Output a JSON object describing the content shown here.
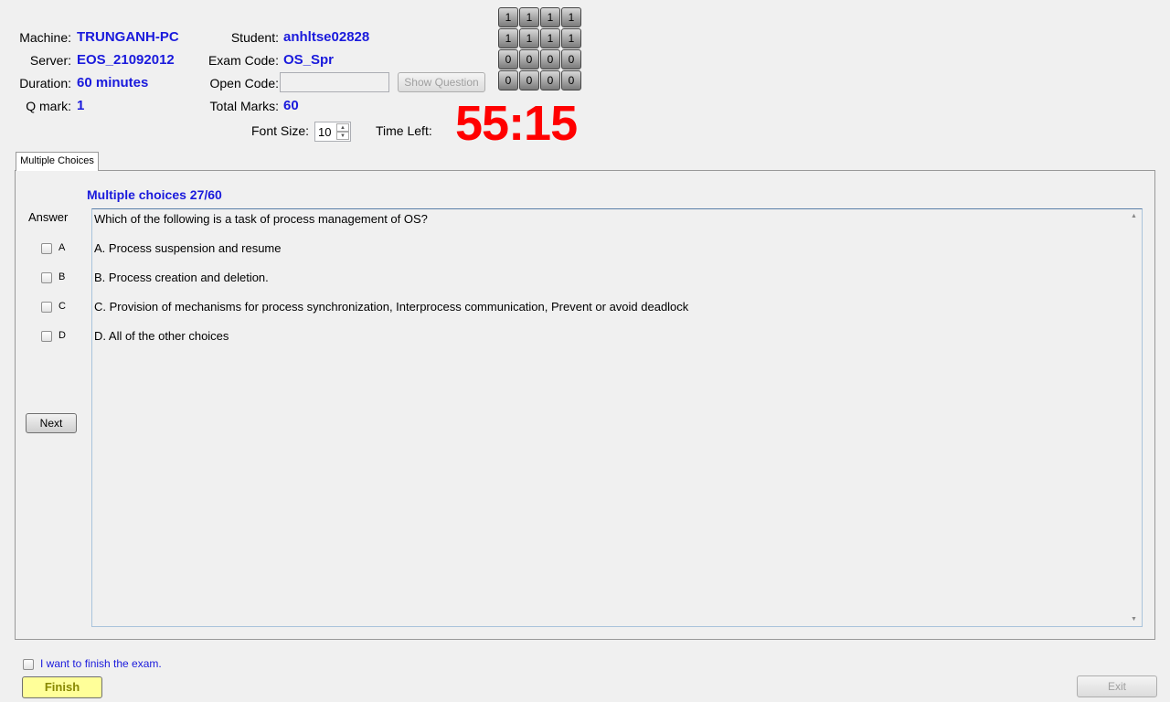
{
  "info": {
    "machine_label": "Machine:",
    "machine": "TRUNGANH-PC",
    "server_label": "Server:",
    "server": "EOS_21092012",
    "duration_label": "Duration:",
    "duration": "60 minutes",
    "qmark_label": "Q mark:",
    "qmark": "1",
    "student_label": "Student:",
    "student": "anhltse02828",
    "examcode_label": "Exam Code:",
    "examcode": "OS_Spr",
    "opencode_label": "Open Code:",
    "opencode_value": "",
    "show_question": "Show Question",
    "totalmarks_label": "Total Marks:",
    "totalmarks": "60",
    "fontsize_label": "Font Size:",
    "fontsize": "10",
    "timeleft_label": "Time Left:",
    "timeleft": "55:15"
  },
  "grid": [
    [
      "1",
      "1",
      "1",
      "1"
    ],
    [
      "1",
      "1",
      "1",
      "1"
    ],
    [
      "0",
      "0",
      "0",
      "0"
    ],
    [
      "0",
      "0",
      "0",
      "0"
    ]
  ],
  "tab": "Multiple Choices",
  "question": {
    "header": "Multiple choices 27/60",
    "answer_label": "Answer",
    "text": "Which of the following is a task of process management of OS?",
    "options": [
      {
        "key": "A",
        "text": "A.  Process suspension and resume"
      },
      {
        "key": "B",
        "text": "B.  Process creation and deletion."
      },
      {
        "key": "C",
        "text": "C.  Provision of mechanisms for process synchronization, Interprocess communication, Prevent or avoid deadlock"
      },
      {
        "key": "D",
        "text": "D.  All of the other choices"
      }
    ],
    "next": "Next"
  },
  "footer": {
    "finish_check": "I want to finish the exam.",
    "finish": "Finish",
    "exit": "Exit"
  },
  "colors": {
    "value": "#1a1adc",
    "timer": "#ff0000",
    "finish_bg": "#ffff99"
  }
}
